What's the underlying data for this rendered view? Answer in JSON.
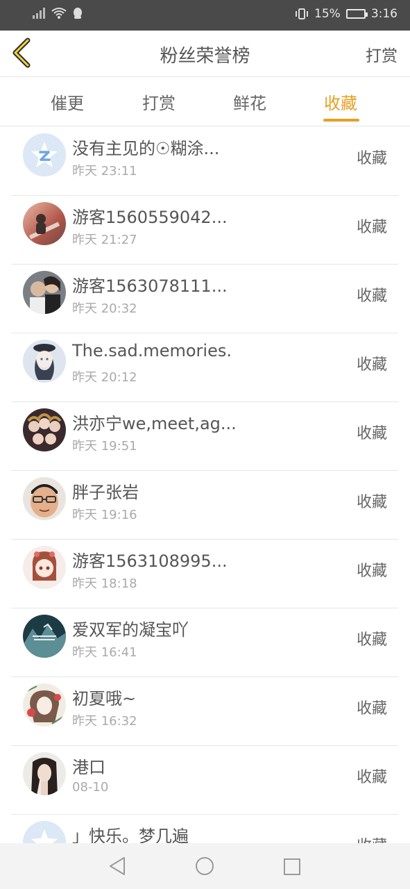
{
  "status_bar": {
    "battery": "15%",
    "time": "3:16"
  },
  "header": {
    "title": "粉丝荣誉榜",
    "right_action": "打赏"
  },
  "tabs": [
    {
      "label": "催更"
    },
    {
      "label": "打赏"
    },
    {
      "label": "鲜花"
    },
    {
      "label": "收藏",
      "active": true
    }
  ],
  "list": [
    {
      "name": "没有主见的☉糊涂...",
      "time": "昨天 23:11",
      "action": "收藏",
      "avatar": "default-avatar-icon"
    },
    {
      "name": "游客1560559042...",
      "time": "昨天 21:27",
      "action": "收藏",
      "avatar": "photo"
    },
    {
      "name": "游客1563078111...",
      "time": "昨天 20:32",
      "action": "收藏",
      "avatar": "photo"
    },
    {
      "name": "The.sad.memories.",
      "time": "昨天 20:12",
      "action": "收藏",
      "avatar": "illustration"
    },
    {
      "name": "洪亦宁we,meet,ag...",
      "time": "昨天 19:51",
      "action": "收藏",
      "avatar": "illustration"
    },
    {
      "name": "胖子张岩",
      "time": "昨天 19:16",
      "action": "收藏",
      "avatar": "cartoon-face"
    },
    {
      "name": "游客1563108995...",
      "time": "昨天 18:18",
      "action": "收藏",
      "avatar": "illustration"
    },
    {
      "name": "爱双军的凝宝吖",
      "time": "昨天 16:41",
      "action": "收藏",
      "avatar": "photo"
    },
    {
      "name": "初夏哦~",
      "time": "昨天 16:32",
      "action": "收藏",
      "avatar": "illustration"
    },
    {
      "name": "港口",
      "time": "08-10",
      "action": "收藏",
      "avatar": "photo"
    },
    {
      "name": "」快乐。梦几遍",
      "time": "",
      "action": "收藏",
      "avatar": "default-avatar-icon"
    }
  ],
  "colors": {
    "accent": "#e8a020",
    "statusbar": "#4a4a4a"
  }
}
